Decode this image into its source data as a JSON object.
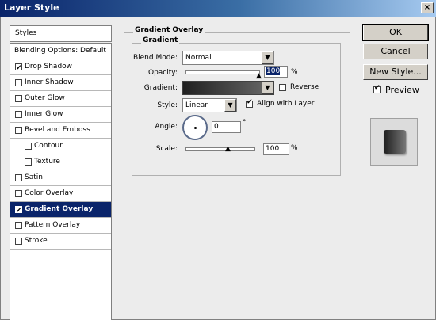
{
  "window": {
    "title": "Layer Style",
    "close_glyph": "×"
  },
  "sidebar": {
    "header": "Styles",
    "items": [
      {
        "label": "Blending Options: Default",
        "checkbox": false,
        "checked": false
      },
      {
        "label": "Drop Shadow",
        "checkbox": true,
        "checked": true
      },
      {
        "label": "Inner Shadow",
        "checkbox": true,
        "checked": false
      },
      {
        "label": "Outer Glow",
        "checkbox": true,
        "checked": false
      },
      {
        "label": "Inner Glow",
        "checkbox": true,
        "checked": false
      },
      {
        "label": "Bevel and Emboss",
        "checkbox": true,
        "checked": false
      },
      {
        "label": "Contour",
        "checkbox": true,
        "checked": false,
        "sub": true
      },
      {
        "label": "Texture",
        "checkbox": true,
        "checked": false,
        "sub": true
      },
      {
        "label": "Satin",
        "checkbox": true,
        "checked": false
      },
      {
        "label": "Color Overlay",
        "checkbox": true,
        "checked": false
      },
      {
        "label": "Gradient Overlay",
        "checkbox": true,
        "checked": true,
        "selected": true
      },
      {
        "label": "Pattern Overlay",
        "checkbox": true,
        "checked": false
      },
      {
        "label": "Stroke",
        "checkbox": true,
        "checked": false
      }
    ]
  },
  "panel": {
    "title": "Gradient Overlay",
    "group_title": "Gradient",
    "blend_mode": {
      "label": "Blend Mode:",
      "value": "Normal"
    },
    "opacity": {
      "label": "Opacity:",
      "value": "100",
      "unit": "%",
      "level": 100
    },
    "gradient": {
      "label": "Gradient:",
      "reverse_label": "Reverse",
      "reverse_checked": false
    },
    "style": {
      "label": "Style:",
      "value": "Linear",
      "align_label": "Align with Layer",
      "align_checked": true
    },
    "angle": {
      "label": "Angle:",
      "value": "0",
      "unit": "°"
    },
    "scale": {
      "label": "Scale:",
      "value": "100",
      "unit": "%",
      "level": 100
    }
  },
  "buttons": {
    "ok": "OK",
    "cancel": "Cancel",
    "new_style": "New Style...",
    "preview_label": "Preview",
    "preview_checked": true
  },
  "icons": {
    "dropdown": "▼",
    "slider_thumb": "▲"
  }
}
